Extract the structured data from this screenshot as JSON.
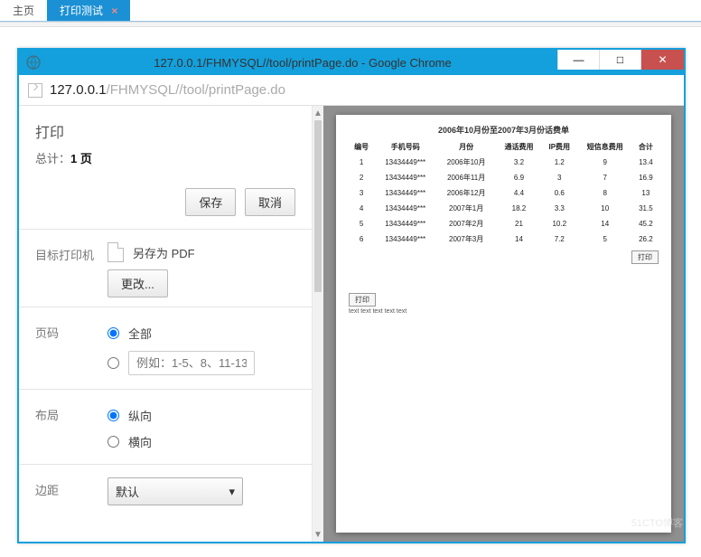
{
  "outer": {
    "tab_main": "主页",
    "tab_print": "打印测试"
  },
  "window": {
    "title": "127.0.0.1/FHMYSQL//tool/printPage.do - Google Chrome",
    "url_dark": "127.0.0.1",
    "url_gray": "/FHMYSQL//tool/printPage.do",
    "minimize": "—",
    "maximize": "□",
    "close": "✕"
  },
  "print": {
    "title": "打印",
    "summary_prefix": "总计：",
    "summary_pages": "1 页",
    "save_btn": "保存",
    "cancel_btn": "取消",
    "dest_label": "目标打印机",
    "dest_value": "另存为 PDF",
    "change_btn": "更改...",
    "pages_label": "页码",
    "pages_all": "全部",
    "pages_range_placeholder": "例如：1-5、8、11-13",
    "layout_label": "布局",
    "layout_portrait": "纵向",
    "layout_landscape": "横向",
    "margin_label": "边距",
    "margin_value": "默认",
    "caret": "▾",
    "scroll_up": "▲",
    "scroll_dn": "▼"
  },
  "chart_data": {
    "type": "table",
    "title": "2006年10月份至2007年3月份话费单",
    "columns": [
      "编号",
      "手机号码",
      "月份",
      "通话费用",
      "IP费用",
      "短信息费用",
      "合计"
    ],
    "rows": [
      [
        "1",
        "13434449***",
        "2006年10月",
        "3.2",
        "1.2",
        "9",
        "13.4"
      ],
      [
        "2",
        "13434449***",
        "2006年11月",
        "6.9",
        "3",
        "7",
        "16.9"
      ],
      [
        "3",
        "13434449***",
        "2006年12月",
        "4.4",
        "0.6",
        "8",
        "13"
      ],
      [
        "4",
        "13434449***",
        "2007年1月",
        "18.2",
        "3.3",
        "10",
        "31.5"
      ],
      [
        "5",
        "13434449***",
        "2007年2月",
        "21",
        "10.2",
        "14",
        "45.2"
      ],
      [
        "6",
        "13434449***",
        "2007年3月",
        "14",
        "7.2",
        "5",
        "26.2"
      ]
    ],
    "print_btn": "打印",
    "footer_text": "text text text text text"
  },
  "watermark": "51CTO博客"
}
